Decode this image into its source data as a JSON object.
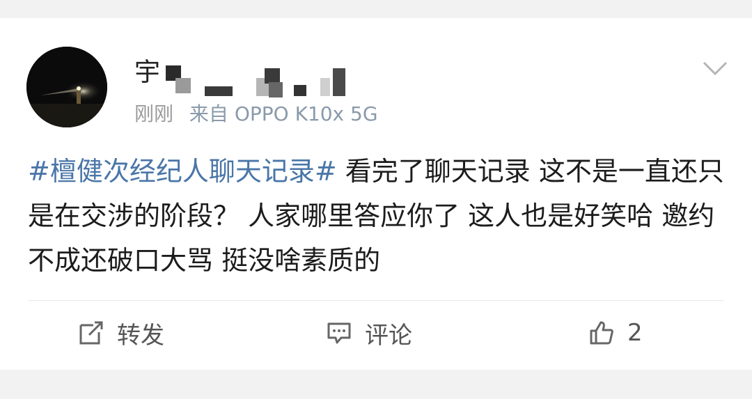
{
  "post": {
    "author": {
      "name_visible": "宇",
      "avatar": "night-lighthouse-avatar"
    },
    "time": "刚刚",
    "source": "来自 OPPO K10x 5G",
    "hashtag": "#檀健次经纪人聊天记录#",
    "body": "看完了聊天记录 这不是一直还只是在交涉的阶段？ 人家哪里答应你了 这人也是好笑哈 邀约不成还破口大骂 挺没啥素质的"
  },
  "actions": {
    "repost_label": "转发",
    "comment_label": "评论",
    "like_count": "2"
  },
  "icons": {
    "repost": "repost-icon",
    "comment": "comment-icon",
    "like": "thumbs-up-icon",
    "menu": "chevron-down-icon"
  },
  "colors": {
    "hashtag": "#4a76a8",
    "text": "#1c1c1c",
    "meta": "#9a9a9a",
    "background": "#f2f2f2"
  }
}
